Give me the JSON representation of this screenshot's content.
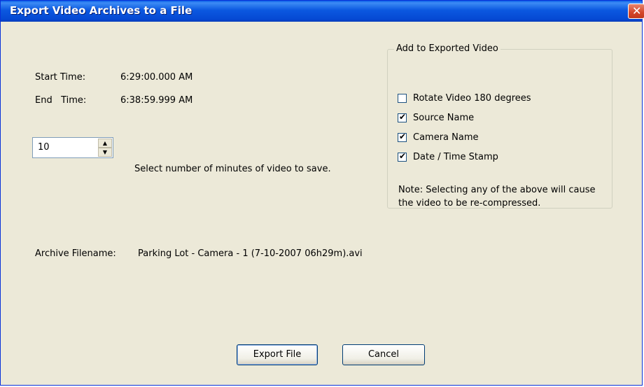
{
  "window": {
    "title": "Export Video Archives to a File",
    "close_glyph": "✕"
  },
  "times": {
    "start_label": "Start Time:",
    "start_value": "6:29:00.000 AM",
    "end_label": "End   Time:",
    "end_value": "6:38:59.999 AM"
  },
  "minutes": {
    "value": "10",
    "up_glyph": "▲",
    "down_glyph": "▼",
    "label": "Select number of minutes of video to save."
  },
  "options": {
    "legend": "Add to Exported Video",
    "items": [
      {
        "label": "Rotate Video 180 degrees",
        "checked": false
      },
      {
        "label": "Source Name",
        "checked": true
      },
      {
        "label": "Camera Name",
        "checked": true
      },
      {
        "label": "Date / Time Stamp",
        "checked": true
      }
    ],
    "note": "Note: Selecting any of the above will cause the video to be re-compressed."
  },
  "archive": {
    "label": "Archive Filename:",
    "filename": "Parking Lot - Camera - 1 (7-10-2007 06h29m).avi"
  },
  "buttons": {
    "export": "Export File",
    "cancel": "Cancel"
  },
  "check_glyph": "✔"
}
